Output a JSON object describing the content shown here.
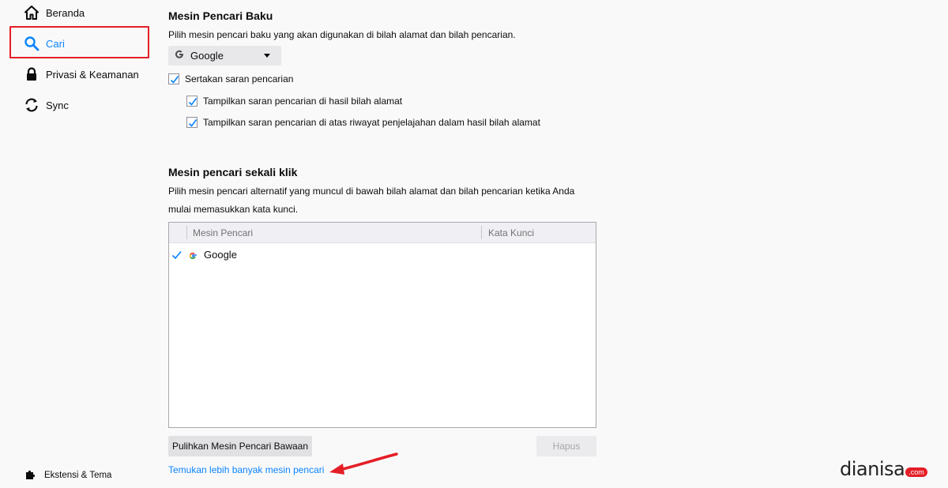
{
  "sidebar": {
    "items": [
      {
        "label": "Beranda",
        "icon": "home-icon"
      },
      {
        "label": "Cari",
        "icon": "search-icon"
      },
      {
        "label": "Privasi & Keamanan",
        "icon": "lock-icon"
      },
      {
        "label": "Sync",
        "icon": "sync-icon"
      }
    ],
    "bottom": {
      "label": "Ekstensi & Tema",
      "icon": "puzzle-icon"
    }
  },
  "default_engine": {
    "heading": "Mesin Pencari Baku",
    "description": "Pilih mesin pencari baku yang akan digunakan di bilah alamat dan bilah pencarian.",
    "selected": "Google",
    "checkboxes": [
      {
        "label": "Sertakan saran pencarian",
        "checked": true
      },
      {
        "label": "Tampilkan saran pencarian di hasil bilah alamat",
        "checked": true
      },
      {
        "label": "Tampilkan saran pencarian di atas riwayat penjelajahan dalam hasil bilah alamat",
        "checked": true
      }
    ]
  },
  "one_click": {
    "heading": "Mesin pencari sekali klik",
    "description_line1": "Pilih mesin pencari alternatif yang muncul di bawah bilah alamat dan bilah pencarian ketika Anda",
    "description_line2": "mulai memasukkan kata kunci.",
    "columns": [
      "Mesin Pencari",
      "Kata Kunci"
    ],
    "rows": [
      {
        "name": "Google",
        "keyword": "",
        "checked": true
      }
    ],
    "restore_button": "Pulihkan Mesin Pencari Bawaan",
    "remove_button": "Hapus",
    "find_more_link": "Temukan lebih banyak mesin pencari"
  },
  "watermark": {
    "main": "dianisa",
    "suffix": ".com"
  },
  "colors": {
    "accent": "#0a84ff",
    "highlight": "#e41e26",
    "arrow": "#e41e26"
  }
}
